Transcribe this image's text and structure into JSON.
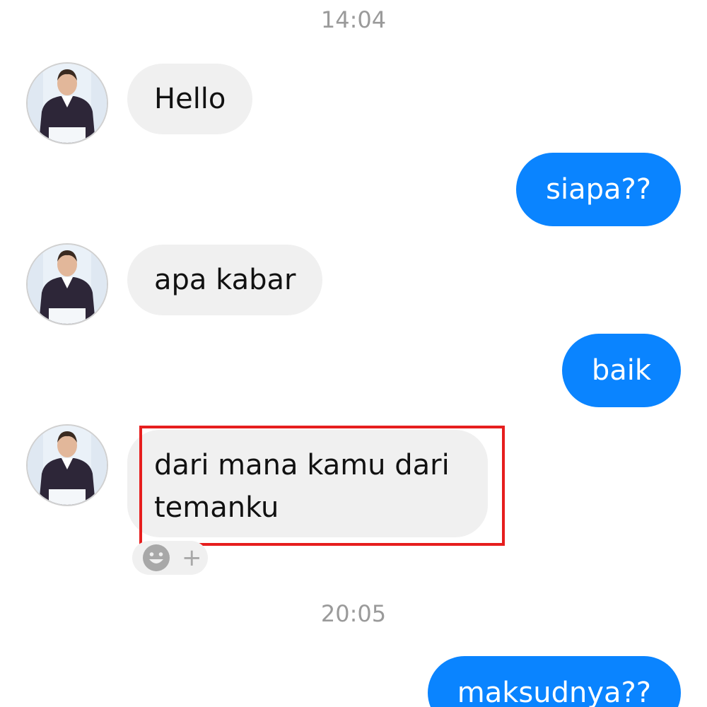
{
  "conversation": {
    "timestamps": [
      "14:04",
      "20:05"
    ],
    "messages": [
      {
        "sender": "other",
        "text": "Hello"
      },
      {
        "sender": "me",
        "text": "siapa??"
      },
      {
        "sender": "other",
        "text": "apa kabar"
      },
      {
        "sender": "me",
        "text": "baik"
      },
      {
        "sender": "other",
        "text": "dari mana kamu dari temanku",
        "highlighted": true
      },
      {
        "sender": "me",
        "text": "maksudnya??"
      }
    ],
    "reaction_bar": {
      "emoji_icon": "smiley-face-icon",
      "plus_label": "+"
    }
  },
  "colors": {
    "outgoing_bubble": "#0a84ff",
    "incoming_bubble": "#f0f0f0",
    "highlight_border": "#e61e1e",
    "timestamp_text": "#9a9a9a"
  }
}
